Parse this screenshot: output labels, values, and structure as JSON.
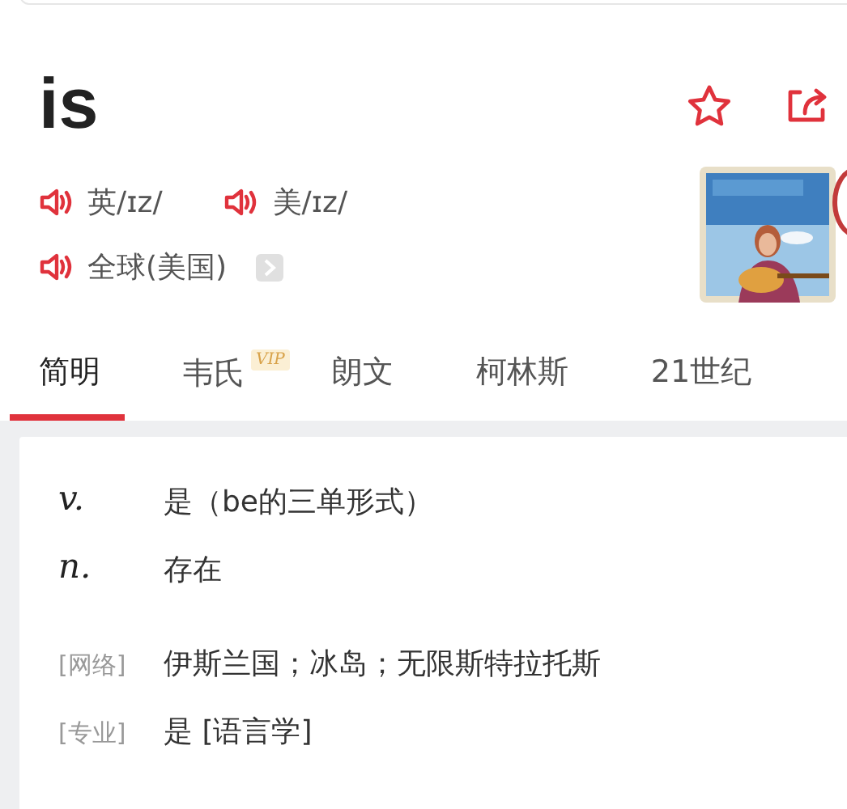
{
  "headword": "is",
  "actions": [
    {
      "kind": "favorite"
    },
    {
      "kind": "share"
    }
  ],
  "pronunciations": [
    {
      "label": "英/ɪz/"
    },
    {
      "label": "美/ɪz/"
    },
    {
      "label": "全球(美国)",
      "more": true
    }
  ],
  "tabs": [
    {
      "label": "简明",
      "selected": true
    },
    {
      "label": "韦氏",
      "selected": false,
      "badge": "VIP"
    },
    {
      "label": "朗文",
      "selected": false
    },
    {
      "label": "柯林斯",
      "selected": false
    },
    {
      "label": "21世纪",
      "selected": false
    }
  ],
  "definitions": [
    {
      "kind": "pos",
      "tag": "v.",
      "text": "是（be的三单形式）"
    },
    {
      "kind": "pos",
      "tag": "n.",
      "text": "存在"
    },
    {
      "kind": "source",
      "tag": "[网络]",
      "text": "伊斯兰国；冰岛；无限斯特拉托斯"
    },
    {
      "kind": "source",
      "tag": "[专业]",
      "text": "是 [语言学]"
    }
  ]
}
